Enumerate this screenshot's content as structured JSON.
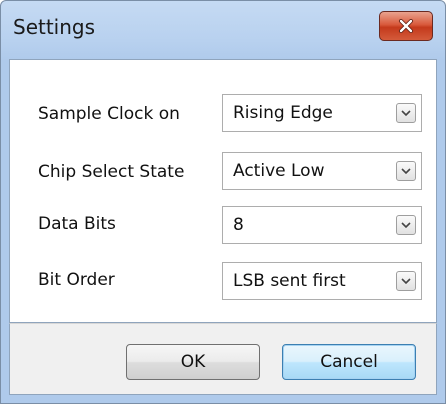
{
  "dialog": {
    "title": "Settings"
  },
  "fields": [
    {
      "label": "Sample Clock on",
      "value": "Rising Edge"
    },
    {
      "label": "Chip Select State",
      "value": "Active Low"
    },
    {
      "label": "Data Bits",
      "value": "8"
    },
    {
      "label": "Bit Order",
      "value": "LSB sent first"
    }
  ],
  "buttons": {
    "ok": "OK",
    "cancel": "Cancel"
  },
  "icons": {
    "close": "close-icon",
    "dropdown": "chevron-down-icon"
  },
  "colors": {
    "title_bar": "#b8d1ef",
    "close_button": "#d45b3b",
    "default_button_border": "#3c7fb1"
  }
}
